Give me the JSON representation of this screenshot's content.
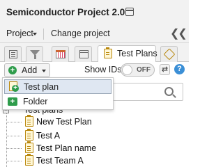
{
  "header": {
    "title": "Semiconductor Project 2.0",
    "window_icon": "window-icon"
  },
  "menu": {
    "project_label": "Project",
    "change_project_label": "Change project",
    "collapse_icon": "double-chevron-left-icon"
  },
  "tabs": [
    {
      "icon": "list-icon",
      "label": ""
    },
    {
      "icon": "filter-icon",
      "label": ""
    },
    {
      "icon": "calendar-icon",
      "label": ""
    },
    {
      "icon": "window-icon",
      "label": ""
    },
    {
      "icon": "test-plan-icon",
      "label": "Test Plans",
      "active": true
    },
    {
      "icon": "tag-icon",
      "label": ""
    }
  ],
  "toolbar": {
    "add_label": "Add",
    "show_ids_label": "Show IDs",
    "toggle_state": "OFF",
    "refresh_icon": "refresh-icon",
    "help_icon": "help-icon",
    "help_glyph": "?"
  },
  "dropdown": {
    "items": [
      {
        "label": "Test plan",
        "icon": "new-test-plan-icon",
        "highlighted": true
      },
      {
        "label": "Folder",
        "icon": "new-folder-icon",
        "highlighted": false
      }
    ]
  },
  "tree": {
    "root_label": "Test plans",
    "items": [
      {
        "label": "New Test Plan"
      },
      {
        "label": "Test A"
      },
      {
        "label": "Test Plan name"
      },
      {
        "label": "Test Team A"
      }
    ]
  }
}
